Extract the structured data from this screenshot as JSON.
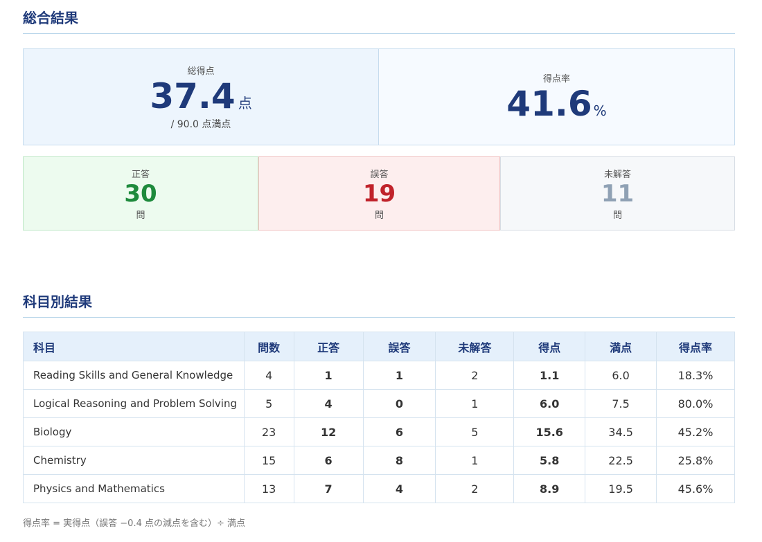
{
  "overall": {
    "title": "総合結果",
    "total_label": "総得点",
    "total_value": "37.4",
    "total_unit": "点",
    "total_sub": "/ 90.0 点満点",
    "rate_label": "得点率",
    "rate_value": "41.6",
    "rate_unit": "%",
    "correct_label": "正答",
    "correct_value": "30",
    "wrong_label": "誤答",
    "wrong_value": "19",
    "blank_label": "未解答",
    "blank_value": "11",
    "count_unit": "問"
  },
  "subjects": {
    "title": "科目別結果",
    "headers": [
      "科目",
      "問数",
      "正答",
      "誤答",
      "未解答",
      "得点",
      "満点",
      "得点率"
    ],
    "rows": [
      [
        "Reading Skills and General Knowledge",
        "4",
        "1",
        "1",
        "2",
        "1.1",
        "6.0",
        "18.3%"
      ],
      [
        "Logical Reasoning and Problem Solving",
        "5",
        "4",
        "0",
        "1",
        "6.0",
        "7.5",
        "80.0%"
      ],
      [
        "Biology",
        "23",
        "12",
        "6",
        "5",
        "15.6",
        "34.5",
        "45.2%"
      ],
      [
        "Chemistry",
        "15",
        "6",
        "8",
        "1",
        "5.8",
        "22.5",
        "25.8%"
      ],
      [
        "Physics and Mathematics",
        "13",
        "7",
        "4",
        "2",
        "8.9",
        "19.5",
        "45.6%"
      ]
    ],
    "note": "得点率 = 実得点（誤答 −0.4 点の減点を含む）÷ 満点"
  },
  "colors": {
    "navy": "#1f3a7a",
    "correct": "#1e8a3c",
    "wrong": "#c0222a",
    "blank": "#8fa1b4"
  }
}
